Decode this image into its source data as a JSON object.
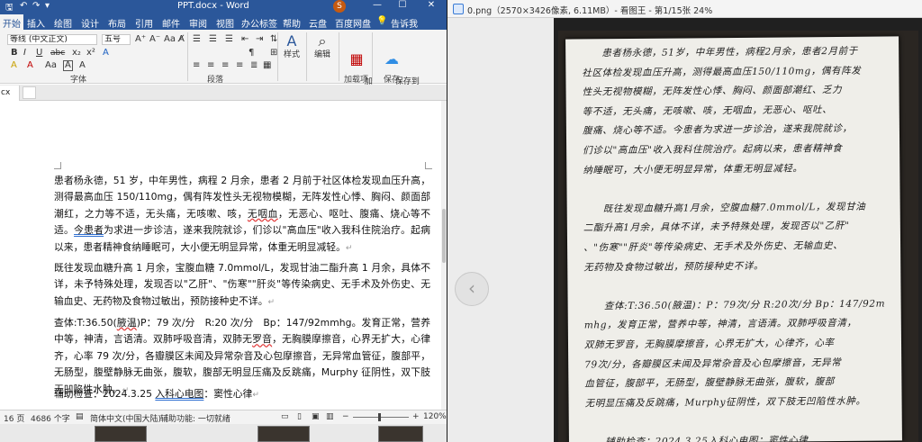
{
  "word": {
    "title": "PPT.docx - Word",
    "user_badge": "S",
    "window_buttons": [
      "—",
      "☐",
      "✕"
    ],
    "qat": [
      "🖫",
      "↶",
      "↷",
      "▾"
    ],
    "tabs": [
      "开始",
      "插入",
      "绘图",
      "设计",
      "布局",
      "引用",
      "邮件",
      "审阅",
      "视图",
      "办公标签",
      "帮助",
      "云盘",
      "百度网盘",
      "💡",
      "告诉我"
    ],
    "ribbon": {
      "font_name": "等线 (中文正文)",
      "font_size": "五号",
      "font_label": "字体",
      "paragraph_label": "段落",
      "styles_button": "样式",
      "edit_button": "编辑",
      "addin_button": "加\n载项",
      "addin_label": "加载项",
      "save_baidu_button": "保存到\n百度网盘",
      "save_label": "保存",
      "font_row2": [
        "B",
        "I",
        "U",
        "abc",
        "x₂",
        "x²",
        "A"
      ],
      "font_row3": [
        "A",
        "A",
        "Aa",
        "A",
        "A"
      ],
      "para_row1": [
        "☰",
        "☰",
        "☰",
        "⇤",
        "⇥",
        "⇅",
        "¶"
      ],
      "para_row2": [
        "≡",
        "≡",
        "≡",
        "≡",
        "≣",
        "▦",
        "⊞"
      ]
    },
    "doc_tab": "cx",
    "paragraphs": {
      "p1a": "患者杨永德，51 岁，中年男性，病程 2 月余，患者 2 月前于社区体检发现血压升高，测得最高血压 150/110mg，偶有阵发性头无视物模糊，无阵发性心悸、胸闷、颜面部潮红，之力等不适，无头痛，无咳嗽、咳，",
      "p1b": "无咽血",
      "p1c": "，无恶心、呕吐、腹痛、烧心等不适。",
      "p1d": "今患者",
      "p1e": "为求进一步诊洁，遂来我院就诊，们诊以\"高血压\"收入我科住院治疗。起病以来，患者精神食纳睡眠可，大小便无明显异常，体重无明显减轻。",
      "p2": "既往发现血糖升高 1 月余，宝腹血糖 7.0mmol/L，发现甘油二酯升高 1 月余，具体不详，未予特殊处理，发现否以\"乙肝\"、\"伤寒\"\"肝炎\"等传染病史、无手术及外伤史、无输血史、无药物及食物过敏出，预防接种史不详。",
      "p3a": "查体:T:36.50(",
      "p3b": "腋温",
      "p3c": ")P：79 次/分　R:20 次/分　Bp：147/92mmhg。发育正常，营养中等，神清，言语清。双肺呼吸音清，双肺无",
      "p3d": "罗音",
      "p3e": "，无胸膜摩擦音，心界无扩大，心律齐，心率 79 次/分，各瓣膜区未闻及异常杂音及心包摩擦音，无异常血管征，腹部平，无肠型，腹壁静脉无曲张，腹软，腹部无明显压痛及反跳痛，Murphy 征阴性，双下肢无凹陷性水肿。",
      "p4a": "辅助检查：2024.3.25 ",
      "p4b": "入科心电图",
      "p4c": "：窦性心律"
    },
    "status": {
      "page": "16 页",
      "words": "4686 个字",
      "lang": "简体中文(中国大陆)",
      "accessibility": "辅助功能: 一切就绪",
      "zoom": "120%"
    }
  },
  "viewer": {
    "title": "0.png（2570×3426像素, 6.11MB）- 看图王 - 第1/15张 24%",
    "prev_icon": "chevron-left-icon",
    "note_lines": [
      "　　患者杨永德，51岁，中年男性，病程2月余，患者2月前于",
      "社区体检发现血压升高，测得最高血压150/110mg，偶有阵发",
      "性头无视物模糊，无阵发性心悸、胸闷、颜面部潮红、乏力",
      "等不适，无头痛，无咳嗽、咳，无咽血，无恶心、呕吐、",
      "腹痛、烧心等不适。今患者为求进一步诊治，遂来我院就诊，",
      "们诊以\"高血压\"收入我科住院治疗。起病以来，患者精神食",
      "纳睡眠可，大小便无明显异常，体重无明显减轻。",
      "",
      "　　既往发现血糖升高1月余，空腹血糖7.0mmol/L，发现甘油",
      "二酯升高1月余，具体不详，未予特殊处理，发现否以\"乙肝\"",
      "、\"伤寒\"\"肝炎\"等传染病史、无手术及外伤史、无输血史、",
      "无药物及食物过敏出，预防接种史不详。",
      "",
      "　　查体:T:36.50(腋温)：P：79次/分  R:20次/分  Bp：147/92m",
      "mhg，发育正常，营养中等，神清，言语清。双肺呼吸音清，",
      "双肺无罗音，无胸膜摩擦音，心界无扩大，心律齐，心率",
      "79次/分，各瓣膜区未闻及异常杂音及心包摩擦音，无异常",
      "血管征，腹部平，无肠型，腹壁静脉无曲张，腹软，腹部",
      "无明显压痛及反跳痛，Murphy征阴性，双下肢无凹陷性水肿。",
      "",
      "　　辅助检查：2024.3.25入科心电图：窦性心律"
    ]
  }
}
